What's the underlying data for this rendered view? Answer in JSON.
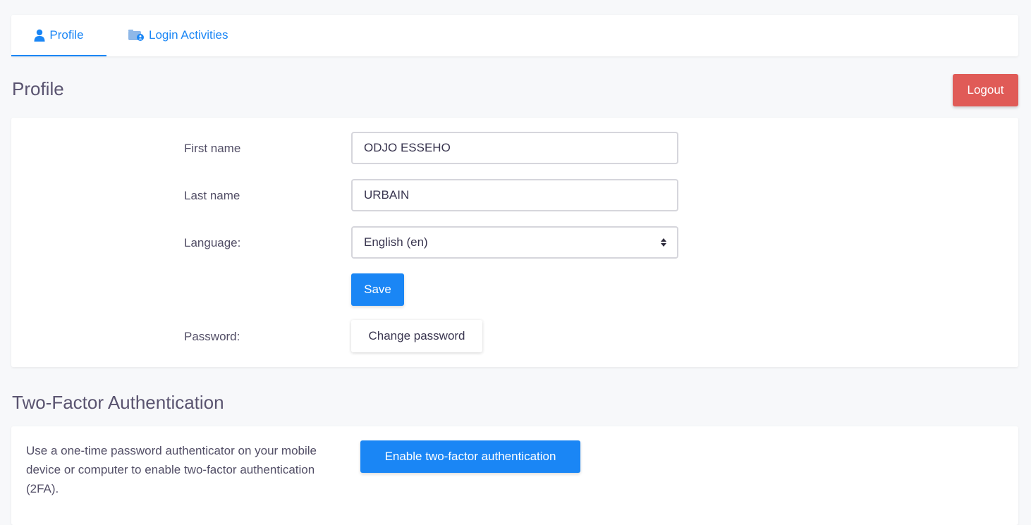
{
  "tabs": [
    {
      "label": "Profile",
      "icon": "user-icon",
      "active": true
    },
    {
      "label": "Login Activities",
      "icon": "login-activities-icon",
      "active": false
    }
  ],
  "profile": {
    "title": "Profile",
    "logout_label": "Logout",
    "fields": {
      "first_name_label": "First name",
      "first_name_value": "ODJO ESSEHO",
      "last_name_label": "Last name",
      "last_name_value": "URBAIN",
      "language_label": "Language:",
      "language_value": "English (en)"
    },
    "save_label": "Save",
    "password_label": "Password:",
    "change_password_label": "Change password"
  },
  "two_factor": {
    "title": "Two-Factor Authentication",
    "description": "Use a one-time password authenticator on your mobile device or computer to enable two-factor authentication (2FA).",
    "enable_label": "Enable two-factor authentication"
  },
  "colors": {
    "accent": "#1a86f5",
    "danger": "#e05b57",
    "background": "#f7f8fa"
  }
}
